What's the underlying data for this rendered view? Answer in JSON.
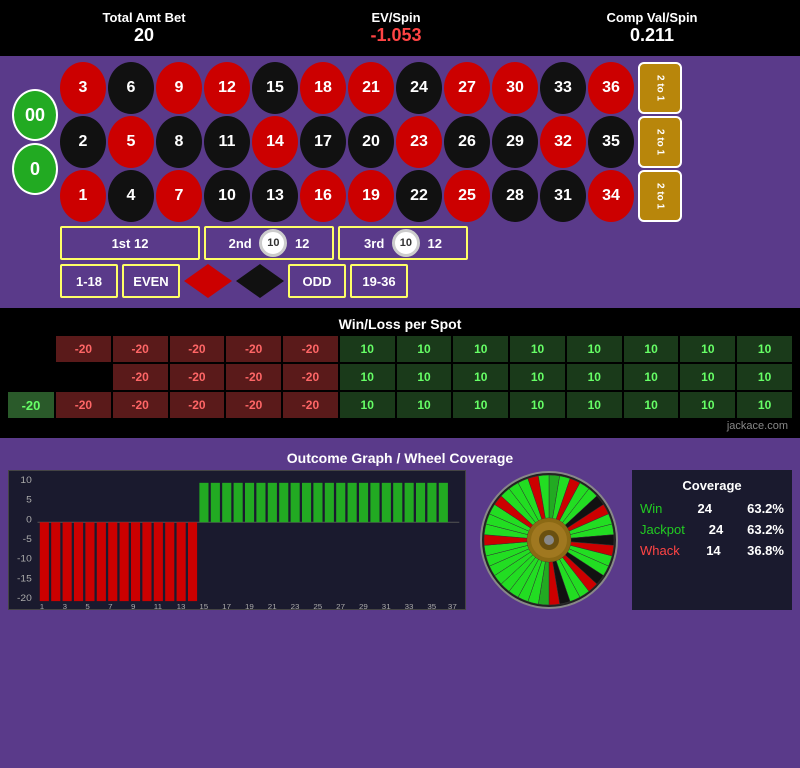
{
  "header": {
    "total_amt_bet_label": "Total Amt Bet",
    "total_amt_bet_value": "20",
    "ev_spin_label": "EV/Spin",
    "ev_spin_value": "-1.053",
    "comp_val_spin_label": "Comp Val/Spin",
    "comp_val_spin_value": "0.211"
  },
  "table": {
    "zero_cells": [
      "00",
      "0"
    ],
    "col_bets": [
      "2 to 1",
      "2 to 1",
      "2 to 1"
    ],
    "numbers": [
      {
        "val": "3",
        "color": "red",
        "row": 1,
        "col": 1
      },
      {
        "val": "6",
        "color": "black",
        "row": 1,
        "col": 2
      },
      {
        "val": "9",
        "color": "red",
        "row": 1,
        "col": 3
      },
      {
        "val": "12",
        "color": "red",
        "row": 1,
        "col": 4
      },
      {
        "val": "15",
        "color": "black",
        "row": 1,
        "col": 5
      },
      {
        "val": "18",
        "color": "red",
        "row": 1,
        "col": 6
      },
      {
        "val": "21",
        "color": "red",
        "row": 1,
        "col": 7
      },
      {
        "val": "24",
        "color": "black",
        "row": 1,
        "col": 8
      },
      {
        "val": "27",
        "color": "red",
        "row": 1,
        "col": 9
      },
      {
        "val": "30",
        "color": "red",
        "row": 1,
        "col": 10
      },
      {
        "val": "33",
        "color": "black",
        "row": 1,
        "col": 11
      },
      {
        "val": "36",
        "color": "red",
        "row": 1,
        "col": 12
      },
      {
        "val": "2",
        "color": "black",
        "row": 2,
        "col": 1
      },
      {
        "val": "5",
        "color": "red",
        "row": 2,
        "col": 2
      },
      {
        "val": "8",
        "color": "black",
        "row": 2,
        "col": 3
      },
      {
        "val": "11",
        "color": "black",
        "row": 2,
        "col": 4
      },
      {
        "val": "14",
        "color": "red",
        "row": 2,
        "col": 5
      },
      {
        "val": "17",
        "color": "black",
        "row": 2,
        "col": 6
      },
      {
        "val": "20",
        "color": "black",
        "row": 2,
        "col": 7
      },
      {
        "val": "23",
        "color": "red",
        "row": 2,
        "col": 8
      },
      {
        "val": "26",
        "color": "black",
        "row": 2,
        "col": 9
      },
      {
        "val": "29",
        "color": "black",
        "row": 2,
        "col": 10
      },
      {
        "val": "32",
        "color": "red",
        "row": 2,
        "col": 11
      },
      {
        "val": "35",
        "color": "black",
        "row": 2,
        "col": 12
      },
      {
        "val": "1",
        "color": "red",
        "row": 3,
        "col": 1
      },
      {
        "val": "4",
        "color": "black",
        "row": 3,
        "col": 2
      },
      {
        "val": "7",
        "color": "red",
        "row": 3,
        "col": 3
      },
      {
        "val": "10",
        "color": "black",
        "row": 3,
        "col": 4
      },
      {
        "val": "13",
        "color": "black",
        "row": 3,
        "col": 5
      },
      {
        "val": "16",
        "color": "red",
        "row": 3,
        "col": 6
      },
      {
        "val": "19",
        "color": "red",
        "row": 3,
        "col": 7
      },
      {
        "val": "22",
        "color": "black",
        "row": 3,
        "col": 8
      },
      {
        "val": "25",
        "color": "red",
        "row": 3,
        "col": 9
      },
      {
        "val": "28",
        "color": "black",
        "row": 3,
        "col": 10
      },
      {
        "val": "31",
        "color": "black",
        "row": 3,
        "col": 11
      },
      {
        "val": "34",
        "color": "red",
        "row": 3,
        "col": 12
      }
    ],
    "dozen_1_label": "1st 12",
    "dozen_2_label": "2nd 12",
    "dozen_3_label": "3rd 12",
    "dozen_2_chip": "10",
    "dozen_3_chip": "10",
    "bet_1_18": "1-18",
    "bet_even": "EVEN",
    "bet_odd": "ODD",
    "bet_19_36": "19-36"
  },
  "winloss": {
    "title": "Win/Loss per Spot",
    "row1": [
      "-20",
      "-20",
      "-20",
      "-20",
      "-20",
      "10",
      "10",
      "10",
      "10",
      "10",
      "10",
      "10",
      "10"
    ],
    "row2": [
      "",
      "-20",
      "-20",
      "-20",
      "-20",
      "10",
      "10",
      "10",
      "10",
      "10",
      "10",
      "10",
      "10"
    ],
    "row3": [
      "-20",
      "-20",
      "-20",
      "-20",
      "-20",
      "10",
      "10",
      "10",
      "10",
      "10",
      "10",
      "10",
      "10"
    ],
    "side_label": "-20",
    "credit": "jackace.com"
  },
  "outcome": {
    "title": "Outcome Graph / Wheel Coverage",
    "graph": {
      "y_labels": [
        "10",
        "5",
        "0",
        "-5",
        "-10",
        "-15",
        "-20"
      ],
      "x_labels": [
        "1",
        "3",
        "5",
        "7",
        "9",
        "11",
        "13",
        "15",
        "17",
        "19",
        "21",
        "23",
        "25",
        "27",
        "29",
        "31",
        "33",
        "35",
        "37"
      ]
    },
    "coverage": {
      "title": "Coverage",
      "win_label": "Win",
      "win_count": "24",
      "win_pct": "63.2%",
      "jackpot_label": "Jackpot",
      "jackpot_count": "24",
      "jackpot_pct": "63.2%",
      "whack_label": "Whack",
      "whack_count": "14",
      "whack_pct": "36.8%"
    }
  }
}
